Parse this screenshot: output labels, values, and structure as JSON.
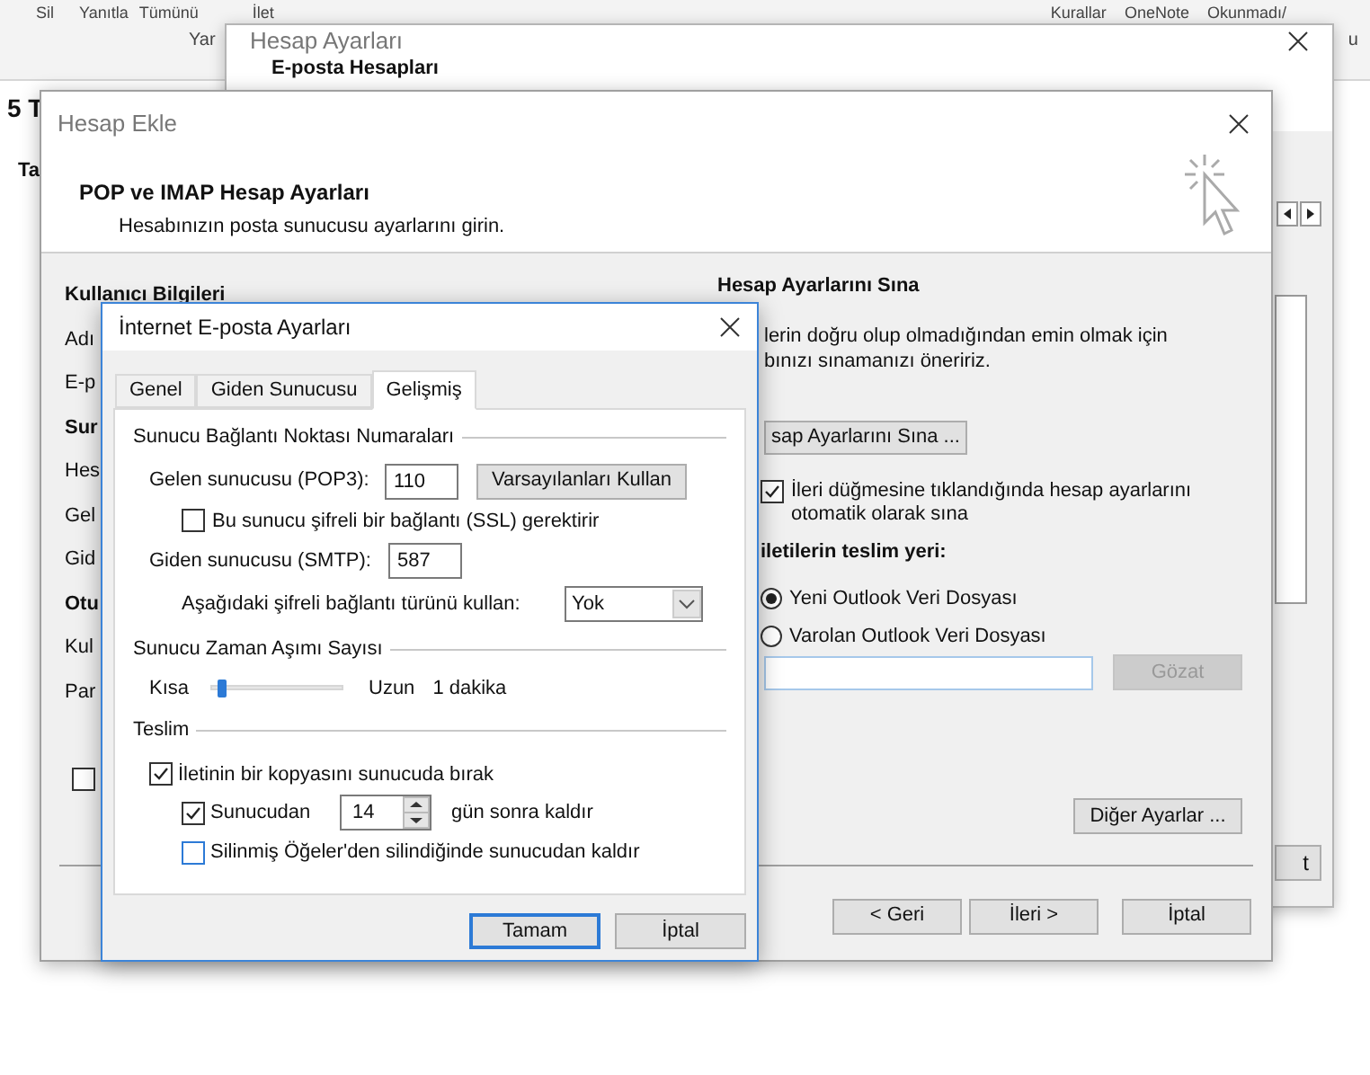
{
  "ribbon": [
    {
      "label": "Sil"
    },
    {
      "label": "Yanıtla"
    },
    {
      "label": "Tümünü"
    },
    {
      "label": "İlet"
    },
    {
      "label": "Kurallar"
    },
    {
      "label": "OneNote"
    },
    {
      "label": "Okunmadı/"
    }
  ],
  "ribbon_second_row": [
    {
      "label": "Yar"
    },
    {
      "label": "u"
    }
  ],
  "mail_pane": {
    "fragments": [
      "5 T",
      "Ta"
    ]
  },
  "account_settings": {
    "title": "Hesap Ayarları",
    "section": "E-posta Hesapları",
    "button_fragment": "t"
  },
  "add_account": {
    "title": "Hesap Ekle",
    "heading": "POP ve IMAP Hesap Ayarları",
    "subheading": "Hesabınızın posta sunucusu ayarlarını girin.",
    "left_labels": [
      {
        "text": "Kullanıcı Bilgileri",
        "bold": true
      },
      {
        "text": "Adı",
        "bold": false
      },
      {
        "text": "E-p",
        "bold": false
      },
      {
        "text": "Sur",
        "bold": true
      },
      {
        "text": "Hes",
        "bold": false
      },
      {
        "text": "Gel",
        "bold": false
      },
      {
        "text": "Gid",
        "bold": false
      },
      {
        "text": "Otu",
        "bold": true
      },
      {
        "text": "Kul",
        "bold": false
      },
      {
        "text": "Par",
        "bold": false
      }
    ],
    "left_checkbox": {
      "checked": false
    },
    "test_heading": "Hesap Ayarlarını Sına",
    "test_text": [
      "lerin doğru olup olmadığından emin olmak için",
      "bınızı sınamanızı öneririz."
    ],
    "test_button": "sap Ayarlarını Sına ...",
    "auto_test": {
      "lines": [
        "İleri düğmesine tıklandığında hesap ayarlarını",
        "otomatik olarak sına"
      ],
      "checked": true
    },
    "delivery_heading": "iletilerin teslim yeri:",
    "delivery_options": [
      {
        "label": "Yeni Outlook Veri Dosyası",
        "selected": true
      },
      {
        "label": "Varolan Outlook Veri Dosyası",
        "selected": false
      }
    ],
    "browse_button": {
      "label": "Gözat",
      "disabled": true
    },
    "more_settings_button": "Diğer Ayarlar ...",
    "buttons": [
      "< Geri",
      "İleri >",
      "İptal"
    ]
  },
  "internet_settings": {
    "title": "İnternet E-posta Ayarları",
    "tabs": [
      {
        "label": "Genel",
        "selected": false
      },
      {
        "label": "Giden Sunucusu",
        "selected": false
      },
      {
        "label": "Gelişmiş",
        "selected": true
      }
    ],
    "port_group": "Sunucu Bağlantı Noktası Numaraları",
    "incoming_label": "Gelen sunucusu (POP3):",
    "incoming_value": "110",
    "defaults_button": "Varsayılanları Kullan",
    "ssl": {
      "label": "Bu sunucu şifreli bir bağlantı (SSL) gerektirir",
      "checked": false
    },
    "outgoing_label": "Giden sunucusu (SMTP):",
    "outgoing_value": "587",
    "encryption_label": "Aşağıdaki şifreli bağlantı türünü kullan:",
    "encryption_value": "Yok",
    "timeout_group": "Sunucu Zaman Aşımı Sayısı",
    "timeout": {
      "min_label": "Kısa",
      "max_label": "Uzun",
      "reading": "1 dakika",
      "level": 0.08
    },
    "delivery_group": "Teslim",
    "leave_copy": {
      "label": "İletinin bir kopyasını sunucuda bırak",
      "checked": true
    },
    "remove_after": {
      "label": "Sunucudan",
      "checked": true,
      "days": "14",
      "suffix": "gün sonra kaldır"
    },
    "remove_deleted": {
      "label": "Silinmiş Öğeler'den silindiğinde sunucudan kaldır",
      "checked": false
    },
    "buttons": [
      {
        "label": "Tamam",
        "default": true
      },
      {
        "label": "İptal",
        "default": false
      }
    ]
  }
}
